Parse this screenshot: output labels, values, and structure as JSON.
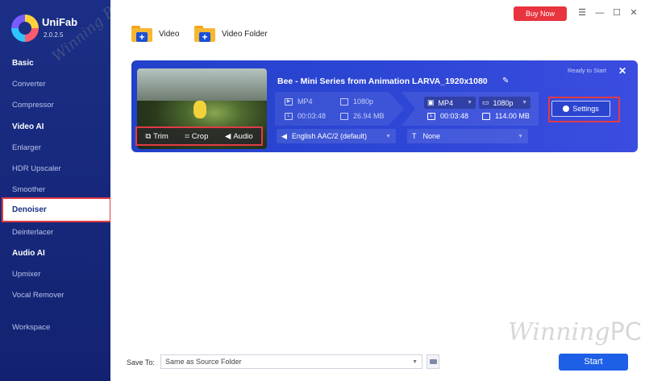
{
  "app": {
    "brand": "UniFab",
    "version": "2.0.2.5"
  },
  "sidebar": {
    "sections": [
      {
        "label": "Basic",
        "items": [
          "Converter",
          "Compressor"
        ]
      },
      {
        "label": "Video AI",
        "items": [
          "Enlarger",
          "HDR Upscaler",
          "Smoother",
          "Denoiser",
          "Deinterlacer"
        ]
      },
      {
        "label": "Audio AI",
        "items": [
          "Upmixer",
          "Vocal Remover"
        ]
      }
    ],
    "workspace": "Workspace",
    "active": "Denoiser"
  },
  "toolbar": {
    "buy_now": "Buy Now",
    "add_video": "Video",
    "add_folder": "Video Folder"
  },
  "task": {
    "title": "Bee - Mini Series from Animation LARVA_1920x1080",
    "status": "Ready to Start",
    "source": {
      "format": "MP4",
      "resolution": "1080p",
      "duration": "00:03:48",
      "size": "26.94 MB"
    },
    "output": {
      "format": "MP4",
      "resolution": "1080p",
      "duration": "00:03:48",
      "size": "114.00 MB"
    },
    "settings_label": "Settings",
    "audio_track": "English AAC/2 (default)",
    "subtitle": "None",
    "tools": {
      "trim": "Trim",
      "crop": "Crop",
      "audio": "Audio"
    }
  },
  "footer": {
    "save_to_label": "Save To:",
    "save_to_value": "Same as Source Folder",
    "start": "Start"
  },
  "watermark": {
    "small": "Winning PC",
    "large_a": "Winning",
    "large_b": "PC"
  },
  "colors": {
    "sidebar": "#1b2f86",
    "accent": "#1d5fe6",
    "buy": "#e8343f",
    "highlight": "#e23b45",
    "card": "#2f47d7"
  }
}
